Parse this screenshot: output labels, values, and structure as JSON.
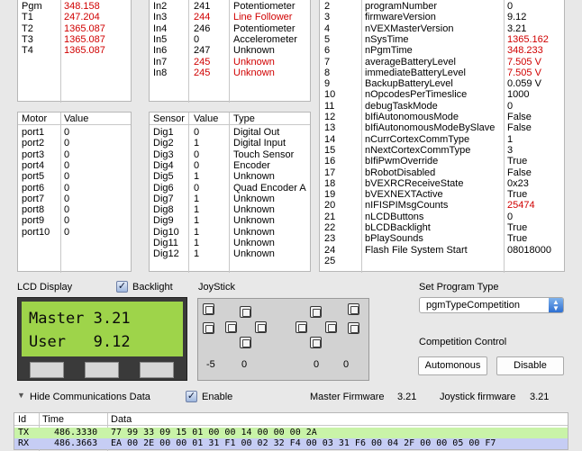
{
  "top_left_rows": [
    {
      "label": "Pgm",
      "value": "348.158",
      "red": true
    },
    {
      "label": "T1",
      "value": "247.204",
      "red": true
    },
    {
      "label": "T2",
      "value": "1365.087",
      "red": true
    },
    {
      "label": "T3",
      "value": "1365.087",
      "red": true
    },
    {
      "label": "T4",
      "value": "1365.087",
      "red": true
    }
  ],
  "analog_rows": [
    {
      "port": "In2",
      "value": "241",
      "type": "Potentiometer",
      "red": false
    },
    {
      "port": "In3",
      "value": "244",
      "type": "Line Follower",
      "red": true
    },
    {
      "port": "In4",
      "value": "246",
      "type": "Potentiometer",
      "red": false
    },
    {
      "port": "In5",
      "value": "0",
      "type": "Accelerometer",
      "red": false
    },
    {
      "port": "In6",
      "value": "247",
      "type": "Unknown",
      "red": false
    },
    {
      "port": "In7",
      "value": "245",
      "type": "Unknown",
      "red": true
    },
    {
      "port": "In8",
      "value": "245",
      "type": "Unknown",
      "red": true
    }
  ],
  "params": [
    {
      "n": "2",
      "name": "programNumber",
      "value": "0",
      "red": false
    },
    {
      "n": "3",
      "name": "firmwareVersion",
      "value": "9.12",
      "red": false
    },
    {
      "n": "4",
      "name": "nVEXMasterVersion",
      "value": "3.21",
      "red": false
    },
    {
      "n": "5",
      "name": "nSysTime",
      "value": "1365.162",
      "red": true
    },
    {
      "n": "6",
      "name": "nPgmTime",
      "value": "348.233",
      "red": true
    },
    {
      "n": "7",
      "name": "averageBatteryLevel",
      "value": "7.505 V",
      "red": true
    },
    {
      "n": "8",
      "name": "immediateBatteryLevel",
      "value": "7.505 V",
      "red": true
    },
    {
      "n": "9",
      "name": "BackupBatteryLevel",
      "value": "0.059 V",
      "red": false
    },
    {
      "n": "10",
      "name": "nOpcodesPerTimeslice",
      "value": "1000",
      "red": false
    },
    {
      "n": "11",
      "name": "debugTaskMode",
      "value": "0",
      "red": false
    },
    {
      "n": "12",
      "name": "bIfiAutonomousMode",
      "value": "False",
      "red": false
    },
    {
      "n": "13",
      "name": "bIfiAutonomousModeBySlave",
      "value": "False",
      "red": false
    },
    {
      "n": "14",
      "name": "nCurrCortexCommType",
      "value": "1",
      "red": false
    },
    {
      "n": "15",
      "name": "nNextCortexCommType",
      "value": "3",
      "red": false
    },
    {
      "n": "16",
      "name": "bIfiPwmOverride",
      "value": "True",
      "red": false
    },
    {
      "n": "17",
      "name": "bRobotDisabled",
      "value": "False",
      "red": false
    },
    {
      "n": "18",
      "name": "bVEXRCReceiveState",
      "value": "0x23",
      "red": false
    },
    {
      "n": "19",
      "name": "bVEXNEXTActive",
      "value": "True",
      "red": false
    },
    {
      "n": "20",
      "name": "nIFISPIMsgCounts",
      "value": "25474",
      "red": true
    },
    {
      "n": "21",
      "name": "nLCDButtons",
      "value": "0",
      "red": false
    },
    {
      "n": "22",
      "name": "bLCDBacklight",
      "value": "True",
      "red": false
    },
    {
      "n": "23",
      "name": "bPlaySounds",
      "value": "True",
      "red": false
    },
    {
      "n": "24",
      "name": "Flash File System Start",
      "value": "08018000",
      "red": false
    },
    {
      "n": "25",
      "name": "",
      "value": "",
      "red": false
    }
  ],
  "motor_table": {
    "headers": [
      "Motor",
      "Value"
    ],
    "rows": [
      {
        "motor": "port1",
        "value": "0"
      },
      {
        "motor": "port2",
        "value": "0"
      },
      {
        "motor": "port3",
        "value": "0"
      },
      {
        "motor": "port4",
        "value": "0"
      },
      {
        "motor": "port5",
        "value": "0"
      },
      {
        "motor": "port6",
        "value": "0"
      },
      {
        "motor": "port7",
        "value": "0"
      },
      {
        "motor": "port8",
        "value": "0"
      },
      {
        "motor": "port9",
        "value": "0"
      },
      {
        "motor": "port10",
        "value": "0"
      }
    ]
  },
  "sensor_table": {
    "headers": [
      "Sensor",
      "Value",
      "Type"
    ],
    "rows": [
      {
        "sensor": "Dig1",
        "value": "0",
        "type": "Digital Out"
      },
      {
        "sensor": "Dig2",
        "value": "1",
        "type": "Digital Input"
      },
      {
        "sensor": "Dig3",
        "value": "0",
        "type": "Touch Sensor"
      },
      {
        "sensor": "Dig4",
        "value": "0",
        "type": "Encoder"
      },
      {
        "sensor": "Dig5",
        "value": "1",
        "type": "Unknown"
      },
      {
        "sensor": "Dig6",
        "value": "0",
        "type": "Quad Encoder A"
      },
      {
        "sensor": "Dig7",
        "value": "1",
        "type": "Unknown"
      },
      {
        "sensor": "Dig8",
        "value": "1",
        "type": "Unknown"
      },
      {
        "sensor": "Dig9",
        "value": "1",
        "type": "Unknown"
      },
      {
        "sensor": "Dig10",
        "value": "1",
        "type": "Unknown"
      },
      {
        "sensor": "Dig11",
        "value": "1",
        "type": "Unknown"
      },
      {
        "sensor": "Dig12",
        "value": "1",
        "type": "Unknown"
      }
    ]
  },
  "lcd": {
    "title": "LCD Display",
    "backlight_label": "Backlight",
    "backlight_checked": true,
    "line1": "Master 3.21",
    "line2": "User   9.12",
    "screen_color": "#9ed44a"
  },
  "joystick": {
    "title": "JoyStick",
    "values": [
      "-5",
      "0",
      "0",
      "0"
    ]
  },
  "program_type": {
    "title": "Set Program Type",
    "selected": "pgmTypeCompetition"
  },
  "competition": {
    "title": "Competition Control",
    "autonomous_label": "Automonous",
    "disable_label": "Disable"
  },
  "comms": {
    "toggle_label": "Hide Communications Data",
    "enable_label": "Enable",
    "enable_checked": true,
    "master_fw_label": "Master Firmware",
    "master_fw_value": "3.21",
    "joystick_fw_label": "Joystick firmware",
    "joystick_fw_value": "3.21",
    "headers": [
      "Id",
      "Time",
      "Data"
    ],
    "rows": [
      {
        "id": "TX",
        "time": "486.3330",
        "data": "77 99 33 09 15 01 00 00 14 00 00 00 2A",
        "color": "#c9f3a8"
      },
      {
        "id": "RX",
        "time": "486.3663",
        "data": "EA 00 2E 00 00 01 31 F1 00 02 32 F4 00 03 31 F6 00 04 2F 00 00 05 00 F7",
        "color": "#c6cdf4"
      }
    ]
  }
}
